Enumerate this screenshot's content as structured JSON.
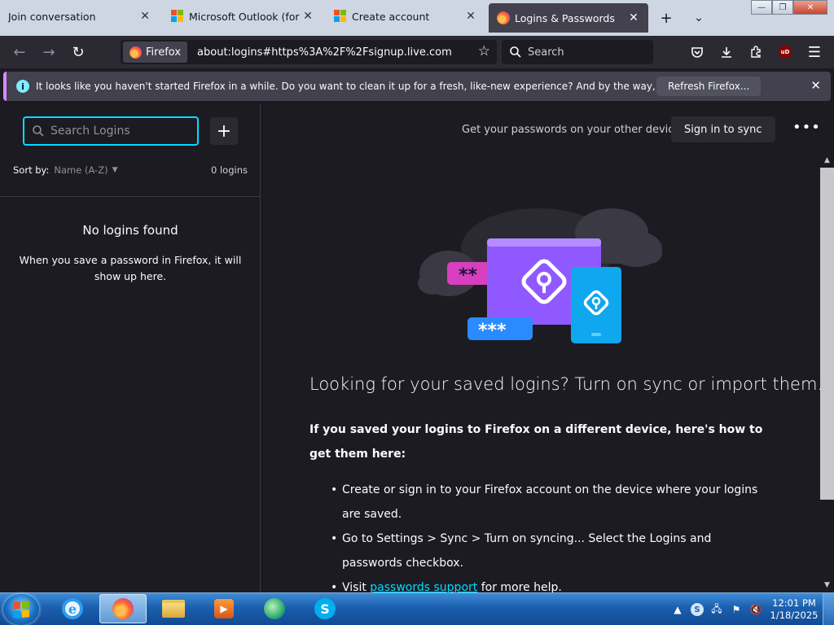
{
  "tabs": [
    {
      "title": "Join conversation",
      "icon": "none",
      "active": false
    },
    {
      "title": "Microsoft Outlook (former",
      "icon": "microsoft-logo",
      "active": false
    },
    {
      "title": "Create account",
      "icon": "microsoft-logo",
      "active": false
    },
    {
      "title": "Logins & Passwords",
      "icon": "firefox-logo",
      "active": true
    }
  ],
  "navbar": {
    "identity_label": "Firefox",
    "url": "about:logins#https%3A%2F%2Fsignup.live.com",
    "search_placeholder": "Search",
    "ublock_label": "uD"
  },
  "notification": {
    "message": "It looks like you haven't started Firefox in a while. Do you want to clean it up for a fresh, like-new experience? And by the way, welcome back!",
    "button": "Refresh Firefox..."
  },
  "logins_list": {
    "search_placeholder": "Search Logins",
    "sort_label": "Sort by:",
    "sort_value": "Name (A-Z)",
    "count": "0 logins",
    "empty_title": "No logins found",
    "empty_desc": "When you save a password in Firefox, it will show up here."
  },
  "main": {
    "sync_prompt": "Get your passwords on your other devices",
    "sync_button": "Sign in to sync",
    "heading": "Looking for your saved logins? Turn on sync or import them.",
    "subheading": "If you saved your logins to Firefox on a different device, here's how to get them here:",
    "steps": {
      "step1": "Create or sign in to your Firefox account on the device where your logins are saved.",
      "step2": "Go to Settings > Sync > Turn on syncing... Select the Logins and passwords checkbox.",
      "step3_prefix": "Visit ",
      "step3_link": "passwords support",
      "step3_suffix": " for more help."
    },
    "illustration_masks": {
      "short": "**",
      "long": "***"
    }
  },
  "taskbar": {
    "time": "12:01 PM",
    "date": "1/18/2025",
    "skype_letter": "S"
  },
  "colors": {
    "accent": "#00ddff",
    "background": "#1c1b22",
    "toolbar": "#2b2a33",
    "notice_border": "#d78bff"
  }
}
